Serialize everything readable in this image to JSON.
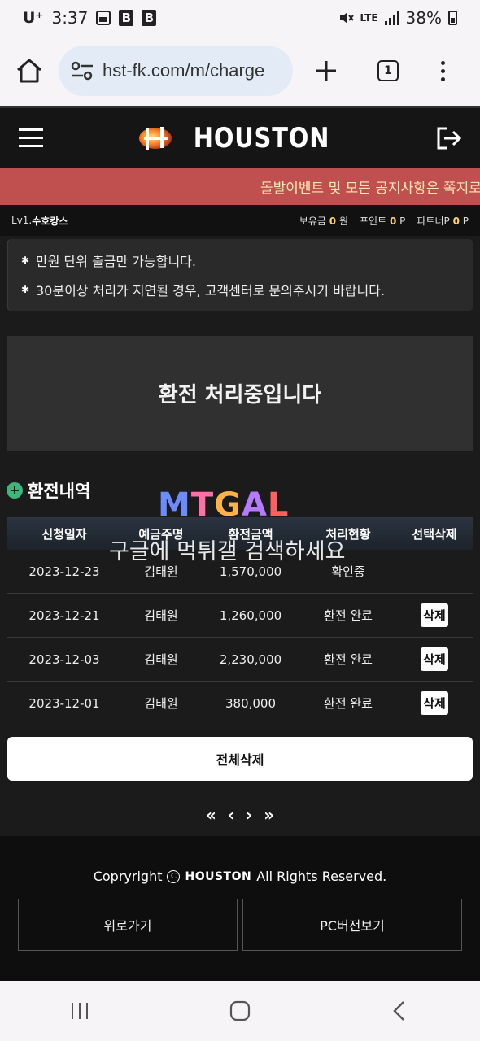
{
  "status_bar": {
    "carrier": "U⁺",
    "time": "3:37",
    "network": "LTE",
    "battery": "38%"
  },
  "browser": {
    "url": "hst-fk.com/m/charge",
    "tab_count": "1"
  },
  "site": {
    "logo_text": "HOUSTON",
    "marquee": "돌발이벤트 및 모든 공지사항은 쪽지로"
  },
  "user": {
    "level": "Lv1.",
    "nickname": "수호캉스",
    "balance_label": "보유금",
    "balance_value": "0",
    "balance_unit": "원",
    "points_label": "포인트",
    "points_value": "0",
    "points_unit": "P",
    "partner_label": "파트너P",
    "partner_value": "0",
    "partner_unit": "P"
  },
  "notices": [
    "만원 단위 출금만 가능합니다.",
    "30분이상 처리가 지연될 경우, 고객센터로 문의주시기 바랍니다."
  ],
  "processing_message": "환전 처리중입니다",
  "history": {
    "title": "환전내역",
    "columns": [
      "신청일자",
      "예금주명",
      "환전금액",
      "처리현황",
      "선택삭제"
    ],
    "rows": [
      {
        "date": "2023-12-23",
        "holder": "김태원",
        "amount": "1,570,000",
        "status": "확인중",
        "action": ""
      },
      {
        "date": "2023-12-21",
        "holder": "김태원",
        "amount": "1,260,000",
        "status": "환전 완료",
        "action": "삭제"
      },
      {
        "date": "2023-12-03",
        "holder": "김태원",
        "amount": "2,230,000",
        "status": "환전 완료",
        "action": "삭제"
      },
      {
        "date": "2023-12-01",
        "holder": "김태원",
        "amount": "380,000",
        "status": "환전 완료",
        "action": "삭제"
      }
    ],
    "delete_all": "전체삭제"
  },
  "pagination": {
    "first": "«",
    "prev": "‹",
    "next": "›",
    "last": "»"
  },
  "watermark": {
    "logo": "MTGAL",
    "text": "구글에 먹튀갤 검색하세요"
  },
  "footer": {
    "copyright_prefix": "Copryright",
    "copyright_logo": "HOUSTON",
    "copyright_suffix": "All Rights Reserved.",
    "back_button": "위로가기",
    "pc_button": "PC버전보기"
  },
  "colors": {
    "marquee_bg": "#c0504f",
    "marquee_text": "#fce9b3",
    "points_accent": "#ffd35c",
    "plus_icon": "#3eb57a"
  }
}
